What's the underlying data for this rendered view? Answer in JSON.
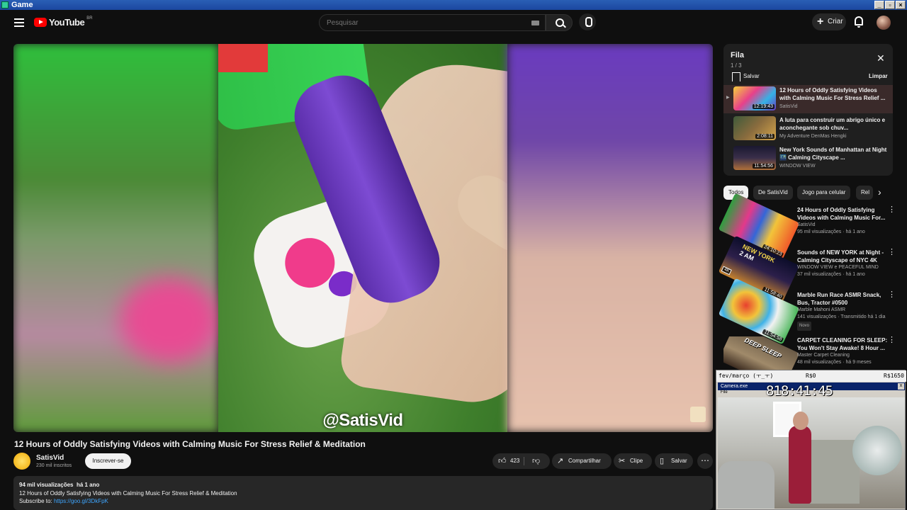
{
  "window": {
    "title": "Game"
  },
  "header": {
    "logo_text": "YouTube",
    "logo_region": "BR",
    "search_placeholder": "Pesquisar",
    "create_label": "Criar"
  },
  "video": {
    "watermark": "@SatisVid",
    "title": "12 Hours of Oddly Satisfying Videos with Calming Music For Stress Relief & Meditation",
    "channel": "SatisVid",
    "subscribers": "230 mil inscritos",
    "subscribe_label": "Inscrever-se",
    "likes": "423",
    "share_label": "Compartilhar",
    "clip_label": "Clipe",
    "save_label": "Salvar"
  },
  "description": {
    "views": "94 mil visualizações",
    "age": "há 1 ano",
    "line1": "12 Hours of Oddly Satisfying Videos with Calming Music For Stress Relief & Meditation",
    "line2_prefix": "Subscribe to:",
    "link": "https://goo.gl/3DkFpK"
  },
  "queue": {
    "title": "Fila",
    "count": "1 / 3",
    "save_label": "Salvar",
    "clear_label": "Limpar",
    "items": [
      {
        "title": "12 Hours of Oddly Satisfying Videos with Calming Music For Stress Relief ...",
        "channel": "SatisVid",
        "duration": "12:19:43"
      },
      {
        "title": "A luta para construir um abrigo único e aconchegante sob chuv...",
        "channel": "My Adventure DenMas Hengki",
        "duration": "2:08:11"
      },
      {
        "title": "New York Sounds of Manhattan at Night 🌃 Calming Cityscape ...",
        "channel": "WINDOW VIEW",
        "duration": "11:54:56"
      }
    ]
  },
  "chips": [
    "Todos",
    "De SatisVid",
    "Jogo para celular",
    "Rel"
  ],
  "recommendations": [
    {
      "title": "24 Hours of Oddly Satisfying Videos with Calming Music For...",
      "channel": "SatisVid",
      "meta": "95 mil visualizações · há 1 ano",
      "duration": "24:10:23"
    },
    {
      "title": "Sounds of NEW YORK at Night - Calming Cityscape of NYC 4K",
      "channel": "WINDOW VIEW e PEACEFUL MIND",
      "meta": "37 mil visualizações · há 1 ano",
      "duration": "11:58:40",
      "thumb_text": "NEW YORK",
      "thumb_sub": "2 AM",
      "badge": "4K"
    },
    {
      "title": "Marble Run Race ASMR Snack, Bus, Tractor #0500",
      "channel": "Marble Mahoni ASMR",
      "meta": "141 visualizações · Transmitido há 1 dia",
      "duration": "11:54:58",
      "new": "Novo"
    },
    {
      "title": "CARPET CLEANING FOR SLEEP: You Won't Stay Awake! 8 Hour ...",
      "channel": "Master Carpet Cleaning",
      "meta": "48 mil visualizações · há 9 meses",
      "thumb_text": "DEEP SLEEP"
    }
  ],
  "stream_overlay": {
    "left_text": "fev/março (ㅜ_ㅜ)",
    "mid_text": "R$0",
    "right_text": "R$1650",
    "camera_title": "Camera.exe",
    "camera_menu": "File",
    "clock": "818:41:45"
  }
}
